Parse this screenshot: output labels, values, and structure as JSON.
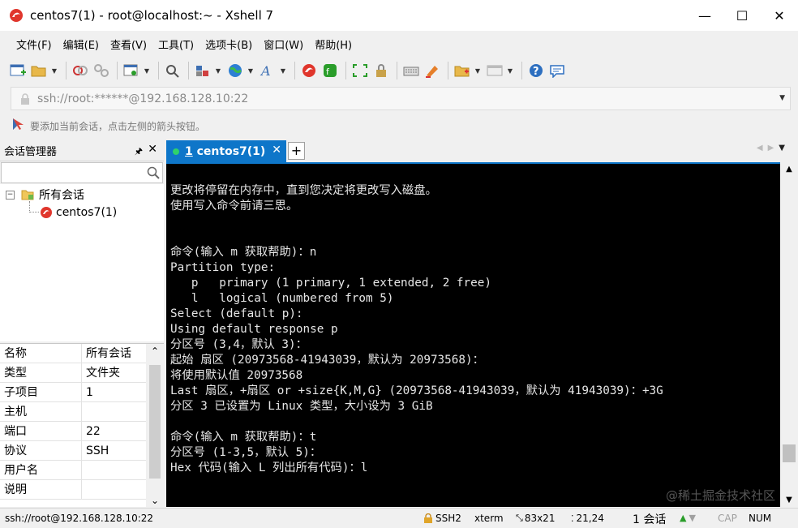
{
  "window": {
    "title": "centos7(1) - root@localhost:~ - Xshell 7",
    "minimize": "—",
    "maximize": "☐",
    "close": "✕"
  },
  "menu": [
    "文件(F)",
    "编辑(E)",
    "查看(V)",
    "工具(T)",
    "选项卡(B)",
    "窗口(W)",
    "帮助(H)"
  ],
  "address": {
    "text": "ssh://root:******@192.168.128.10:22"
  },
  "hint": {
    "text": "要添加当前会话，点击左侧的箭头按钮。"
  },
  "session_manager": {
    "title": "会话管理器",
    "pin": "🖈",
    "close": "✕",
    "search_placeholder": "",
    "tree": {
      "folder": "所有会话",
      "expand": "−",
      "session": "centos7(1)"
    },
    "properties": [
      {
        "key": "名称",
        "value": "所有会话"
      },
      {
        "key": "类型",
        "value": "文件夹"
      },
      {
        "key": "子项目",
        "value": "1"
      },
      {
        "key": "主机",
        "value": ""
      },
      {
        "key": "端口",
        "value": "22"
      },
      {
        "key": "协议",
        "value": "SSH"
      },
      {
        "key": "用户名",
        "value": ""
      },
      {
        "key": "说明",
        "value": ""
      }
    ]
  },
  "tab": {
    "number": "1",
    "label": "centos7(1)",
    "close": "✕",
    "add": "+"
  },
  "terminal": {
    "lines": [
      "更改将停留在内存中，直到您决定将更改写入磁盘。",
      "使用写入命令前请三思。",
      "",
      "",
      "命令(输入 m 获取帮助)：n",
      "Partition type:",
      "   p   primary (1 primary, 1 extended, 2 free)",
      "   l   logical (numbered from 5)",
      "Select (default p):",
      "Using default response p",
      "分区号 (3,4，默认 3)：",
      "起始 扇区 (20973568-41943039，默认为 20973568)：",
      "将使用默认值 20973568",
      "Last 扇区，+扇区 or +size{K,M,G} (20973568-41943039，默认为 41943039)：+3G",
      "分区 3 已设置为 Linux 类型，大小设为 3 GiB",
      "",
      "命令(输入 m 获取帮助)：t",
      "分区号 (1-3,5，默认 5)：",
      "Hex 代码(输入 L 列出所有代码)：l"
    ],
    "watermark": "@稀土掘金技术社区"
  },
  "status": {
    "connection": "ssh://root@192.168.128.10:22",
    "protocol": "SSH2",
    "terminal_type": "xterm",
    "size": "83x21",
    "cursor": "21,24",
    "sessions": "1 会话",
    "cap": "CAP",
    "num": "NUM"
  },
  "colors": {
    "tab_active": "#0e76c9",
    "terminal_bg": "#000000",
    "terminal_fg": "#e6e6e6"
  }
}
